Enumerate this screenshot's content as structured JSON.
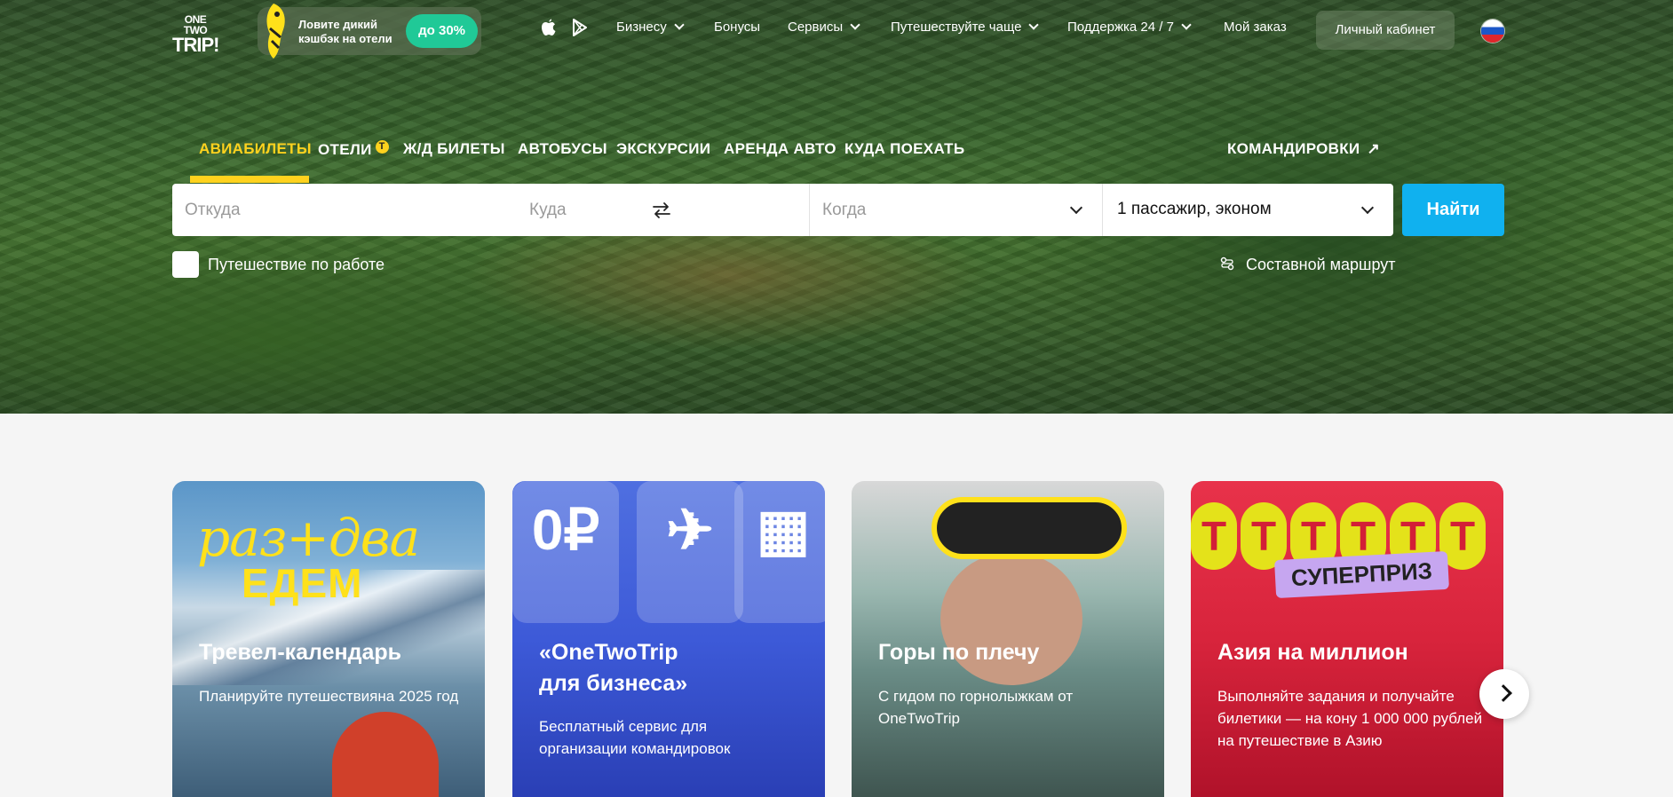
{
  "header": {
    "logo_line1": "ONE TWO",
    "logo_line2": "TRIP!",
    "promo_text": "Ловите дикий кэшбэк на отели",
    "promo_badge": "до 30%",
    "nav": [
      {
        "label": "Бизнесу",
        "dropdown": true
      },
      {
        "label": "Бонусы",
        "dropdown": false
      },
      {
        "label": "Сервисы",
        "dropdown": true
      },
      {
        "label": "Путешествуйте чаще",
        "dropdown": true
      },
      {
        "label": "Поддержка 24 / 7",
        "dropdown": true
      },
      {
        "label": "Мой заказ",
        "dropdown": false
      }
    ],
    "cabinet": "Личный кабинет",
    "icons": [
      "apple-icon",
      "google-play-icon",
      "russia-flag-icon"
    ]
  },
  "product_tabs": {
    "items": [
      "АВИАБИЛЕТЫ",
      "ОТЕЛИ",
      "Ж/Д БИЛЕТЫ",
      "АВТОБУСЫ",
      "ЭКСКУРСИИ",
      "АРЕНДА АВТО",
      "КУДА ПОЕХАТЬ"
    ],
    "active": "АВИАБИЛЕТЫ",
    "hotels_coin": "T",
    "business": "КОМАНДИРОВКИ",
    "accent_color": "#ffd21e"
  },
  "search": {
    "from_placeholder": "Откуда",
    "to_placeholder": "Куда",
    "when_placeholder": "Когда",
    "passengers": "1 пассажир, эконом",
    "button": "Найти",
    "button_color": "#10b1ef",
    "work_trip_label": "Путешествие по работе",
    "work_trip_checked": false,
    "complex_route": "Составной маршрут"
  },
  "cards": [
    {
      "title": "Тревел-календарь",
      "text": "Планируйте путешествияна 2025 год",
      "art_a": "раз+два",
      "art_b": "ЕДЕМ"
    },
    {
      "title": "«OneTwoTrip для бизнеса»",
      "text": "Бесплатный сервис для организации командировок",
      "tiles": [
        "0₽",
        "✈",
        "▦"
      ]
    },
    {
      "title": "Горы по плечу",
      "text": "С гидом по горнолыжкам от OneTwoTrip"
    },
    {
      "title": "Азия на миллион",
      "text": "Выполняйте задания и получайте билетики — на кону 1 000 000 рублей на путешествие в Азию",
      "coin": "T",
      "prize": "СУПЕРПРИЗ"
    }
  ]
}
